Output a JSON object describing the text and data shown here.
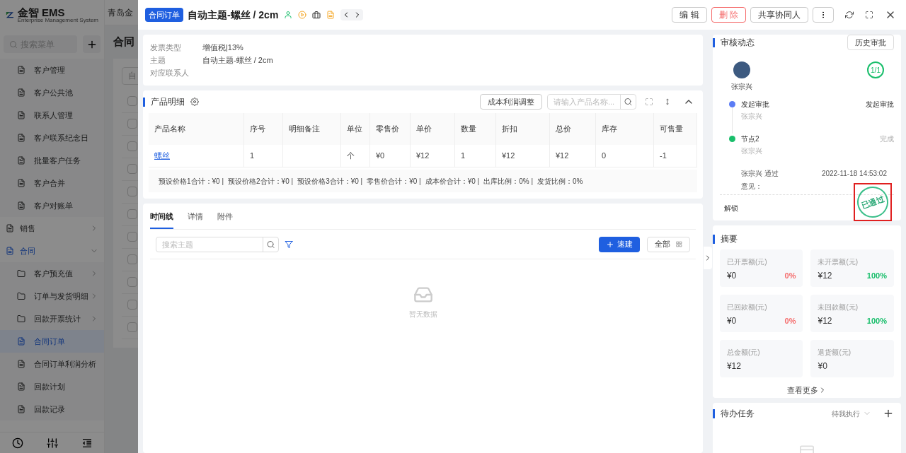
{
  "app": {
    "logo_name": "金智 EMS",
    "logo_tagline": "Enterprise Management System",
    "company": "青岛金"
  },
  "sidebar": {
    "search": {
      "placeholder": "搜索菜单"
    },
    "open_group_items": [
      {
        "label": "客户管理",
        "has_submenu": false,
        "selected": false
      },
      {
        "label": "客户公共池",
        "has_submenu": false,
        "selected": false
      },
      {
        "label": "联系人管理",
        "has_submenu": false,
        "selected": false
      },
      {
        "label": "客户联系纪念日",
        "has_submenu": false,
        "selected": false
      },
      {
        "label": "批量客户任务",
        "has_submenu": false,
        "selected": false
      },
      {
        "label": "客户合并",
        "has_submenu": false,
        "selected": false
      },
      {
        "label": "客户对账单",
        "has_submenu": false,
        "selected": false
      }
    ],
    "groups": [
      {
        "label": "销售",
        "expanded": false,
        "active": false
      },
      {
        "label": "合同",
        "expanded": true,
        "active": true,
        "children": [
          {
            "label": "客户预充值",
            "has_submenu": true,
            "selected": false
          },
          {
            "label": "订单与发货明细",
            "has_submenu": true,
            "selected": false
          },
          {
            "label": "回款开票统计",
            "has_submenu": true,
            "selected": false
          },
          {
            "label": "合同订单",
            "has_submenu": false,
            "selected": true
          },
          {
            "label": "合同订单利润分析",
            "has_submenu": false,
            "selected": false
          },
          {
            "label": "回款计划",
            "has_submenu": false,
            "selected": false
          },
          {
            "label": "回款记录",
            "has_submenu": false,
            "selected": false
          }
        ]
      }
    ]
  },
  "background_page": {
    "title": "合同",
    "button": "自",
    "checkbox_rows": [
      {
        "checked": false
      },
      {
        "checked": false
      },
      {
        "checked": false
      },
      {
        "checked": false
      },
      {
        "checked": false
      },
      {
        "checked": false
      },
      {
        "checked": false
      },
      {
        "checked": false
      },
      {
        "checked": false
      },
      {
        "checked": false
      },
      {
        "checked": false
      }
    ]
  },
  "drawer": {
    "tag": "合同订单",
    "title": "自动主题-螺丝 / 2cm",
    "actions": [
      {
        "label": "编 辑",
        "kind": "default"
      },
      {
        "label": "删 除",
        "kind": "danger"
      },
      {
        "label": "共享协同人",
        "kind": "default"
      }
    ],
    "info": [
      {
        "label": "发票类型",
        "value": "增值税|13%"
      },
      {
        "label": "主题",
        "value": "自动主题-螺丝 / 2cm"
      },
      {
        "label": "对应联系人"
      }
    ],
    "products": {
      "title": "产品明细",
      "adjust_button": "成本利润调整",
      "search": {
        "placeholder": "请输入产品名称..."
      },
      "columns": [
        "产品名称",
        "序号",
        "明细备注",
        "单位",
        "零售价",
        "单价",
        "数量",
        "折扣",
        "总价",
        "库存",
        "可售量"
      ],
      "rows": [
        {
          "cells": [
            "螺丝",
            "1",
            null,
            "个",
            "¥0",
            "¥12",
            "1",
            "¥12",
            "¥12",
            "0",
            "-1"
          ]
        }
      ],
      "totals": [
        "预设价格1合计：¥0 |",
        "预设价格2合计：¥0 |",
        "预设价格3合计：¥0 |",
        "零售价合计：¥0 |",
        "成本价合计：¥0 |",
        "出库比例：0% |",
        "发货比例：0%"
      ]
    },
    "tabs": [
      {
        "label": "时间线",
        "selected": true
      },
      {
        "label": "详情",
        "selected": false
      },
      {
        "label": "附件",
        "selected": false
      }
    ],
    "timeline": {
      "search": {
        "placeholder": "搜索主题"
      },
      "create_button": "速建",
      "all_button": "全部",
      "empty_text": "暂无数据"
    },
    "approval": {
      "title": "审核动态",
      "history_button": "历史审批",
      "approver": "张宗兴",
      "progress": "1/1",
      "steps": [
        {
          "kind": "start",
          "title": "发起审批",
          "person": "张宗兴",
          "status": "发起审批"
        },
        {
          "kind": "approve",
          "title": "节点2",
          "person": "张宗兴",
          "status": "完成"
        }
      ],
      "result": "张宗兴 通过",
      "time": "2022-11-18 14:53:02",
      "comment_label": "意见：",
      "unlock": "解锁",
      "stamp": "已通过"
    },
    "summary": {
      "title": "摘要",
      "tiles": [
        {
          "label": "已开票额(元)",
          "amount": "¥0",
          "percent": "0%",
          "color": "#f56c6c"
        },
        {
          "label": "未开票额(元)",
          "amount": "¥12",
          "percent": "100%",
          "color": "#19be6b"
        },
        {
          "label": "已回款额(元)",
          "amount": "¥0",
          "percent": "0%",
          "color": "#f56c6c"
        },
        {
          "label": "未回款额(元)",
          "amount": "¥12",
          "percent": "100%",
          "color": "#19be6b"
        },
        {
          "label": "总金额(元)",
          "amount": "¥12"
        },
        {
          "label": "退货额(元)",
          "amount": "¥0"
        }
      ],
      "more": "查看更多"
    },
    "tasks": {
      "title": "待办任务",
      "filter": "待我执行"
    }
  }
}
